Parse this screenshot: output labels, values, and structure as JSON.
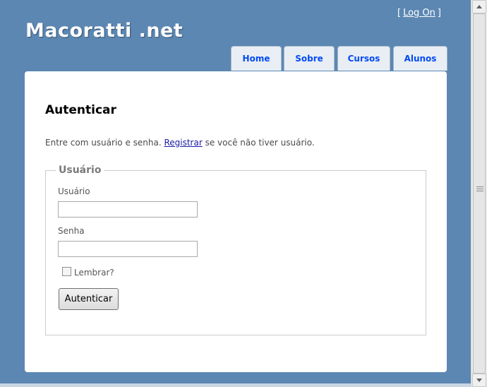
{
  "header": {
    "site_title": "Macoratti .net",
    "login": {
      "open": "[",
      "link": "Log On",
      "close": "]"
    }
  },
  "nav": {
    "tabs": [
      {
        "label": "Home"
      },
      {
        "label": "Sobre"
      },
      {
        "label": "Cursos"
      },
      {
        "label": "Alunos"
      }
    ]
  },
  "main": {
    "title": "Autenticar",
    "intro_before": "Entre com usuário e senha. ",
    "intro_link": "Registrar",
    "intro_after": " se você não tiver usuário.",
    "fieldset": {
      "legend": "Usuário",
      "username_label": "Usuário",
      "username_value": "",
      "password_label": "Senha",
      "password_value": "",
      "remember_label": "Lembrar?",
      "remember_checked": false,
      "submit_label": "Autenticar"
    }
  },
  "colors": {
    "page_background": "#5c87b2",
    "tab_text": "#034af3",
    "tab_background": "#e8eef4"
  },
  "icons": [
    "scroll-up-arrow-icon",
    "scroll-down-arrow-icon",
    "scroll-thumb-grip-icon"
  ]
}
